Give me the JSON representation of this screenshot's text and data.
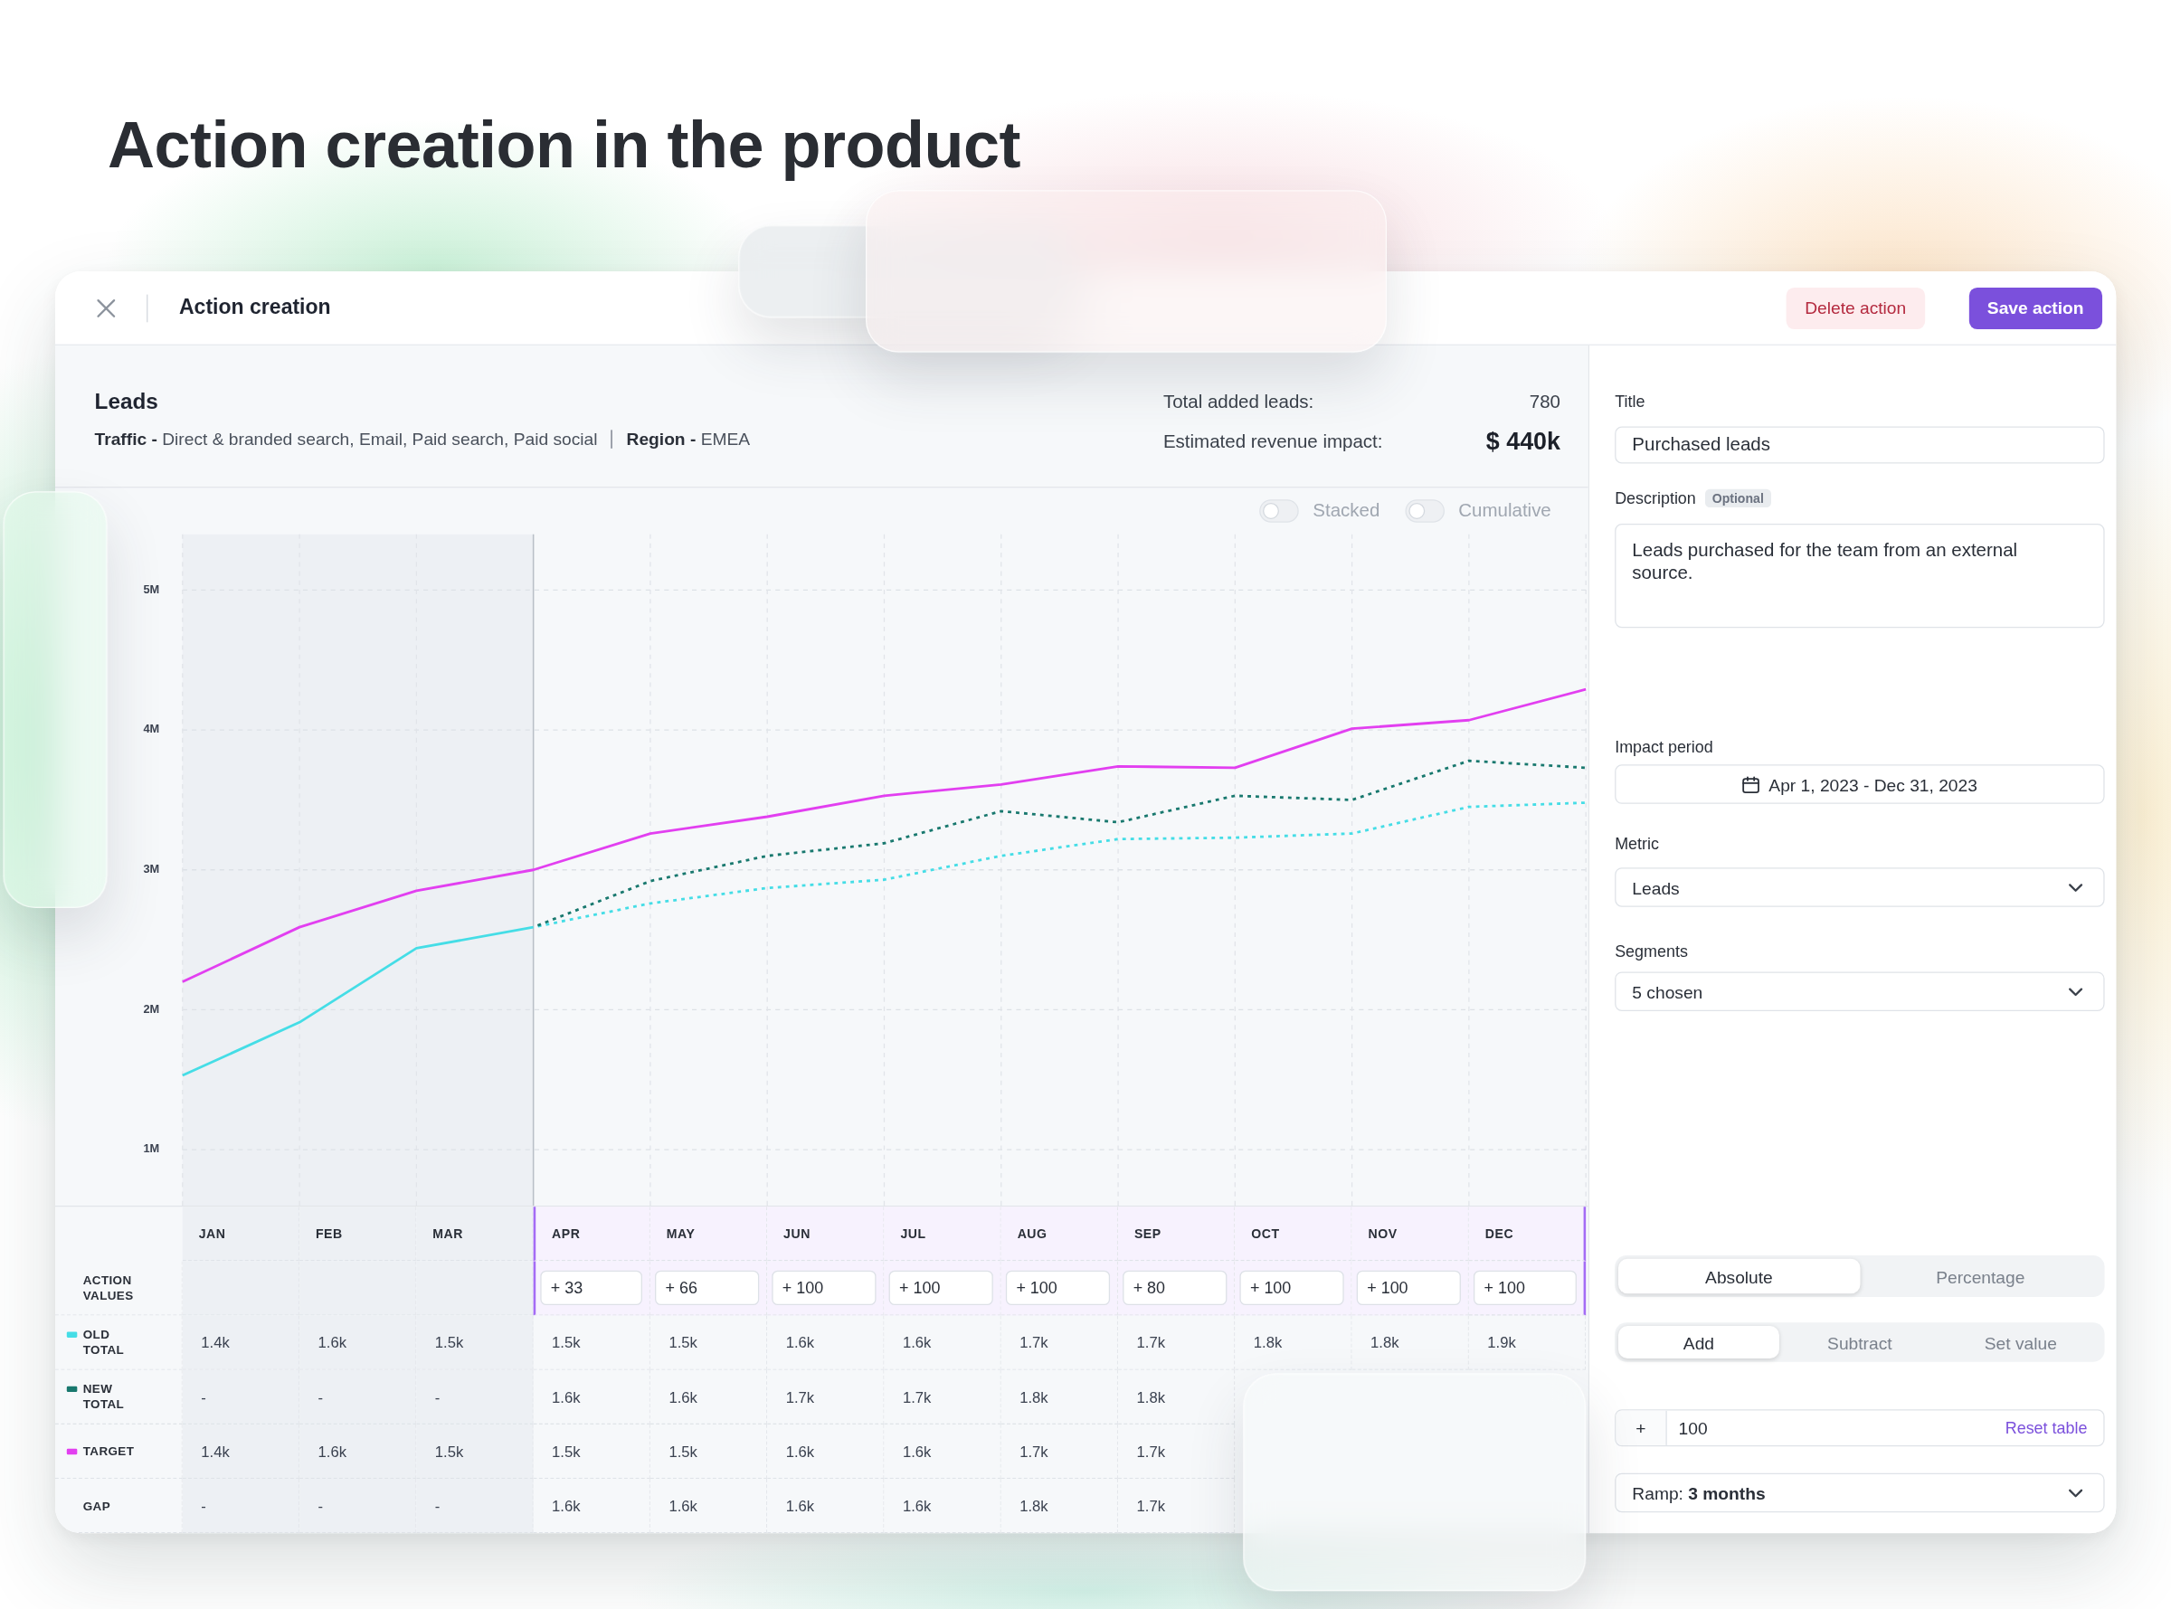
{
  "page_title": "Action creation in the product",
  "window": {
    "title": "Action creation",
    "buttons": [
      {
        "label": "Delete action",
        "kind": "danger"
      },
      {
        "label": "Save action",
        "kind": "primary"
      }
    ]
  },
  "metric_header": {
    "title": "Leads",
    "filters": [
      "**Traffic -** Direct & branded search, Email, Paid search, Paid social",
      "**Region -** EMEA"
    ],
    "stats": [
      {
        "label": "Total added leads:",
        "value": "780",
        "kind": "plain"
      },
      {
        "label": "Estimated revenue impact:",
        "value": "$ 440k",
        "kind": "emphasis"
      }
    ]
  },
  "chart": {
    "toggles": [
      {
        "label": "Stacked",
        "on": false
      },
      {
        "label": "Cumulative",
        "on": false
      }
    ],
    "chart_data": {
      "type": "line",
      "categories": [
        null,
        null,
        null,
        null,
        null,
        null,
        null,
        null,
        null,
        null,
        null,
        null,
        null
      ],
      "ylim": [
        0.6,
        5.4
      ],
      "yticks": [
        {
          "value": 1,
          "label": "1M"
        },
        {
          "value": 2,
          "label": "2M"
        },
        {
          "value": 3,
          "label": "3M"
        },
        {
          "value": 4,
          "label": "4M"
        },
        {
          "value": 5,
          "label": "5M"
        }
      ],
      "grid": true,
      "series": [
        {
          "color": "#45dde6",
          "line_style": "dashed",
          "values": [
            1.53,
            1.91,
            2.44,
            2.59,
            2.76,
            2.87,
            2.93,
            3.1,
            3.22,
            3.23,
            3.26,
            3.45,
            3.48
          ]
        },
        {
          "color": "#18786e",
          "line_style": "dashed",
          "values": [
            null,
            null,
            null,
            2.59,
            2.92,
            3.1,
            3.19,
            3.42,
            3.34,
            3.53,
            3.5,
            3.78,
            3.73
          ]
        },
        {
          "color": "#e23ff0",
          "line_style": "solid",
          "values": [
            2.2,
            2.59,
            2.85,
            3.0,
            3.26,
            3.38,
            3.53,
            3.61,
            3.74,
            3.73,
            4.01,
            4.07,
            4.29
          ]
        }
      ]
    }
  },
  "table": {
    "row_labels": [
      {
        "label": "ACTION VALUES",
        "kind": "input"
      },
      {
        "label": "OLD TOTAL",
        "kind": "value",
        "color": "#45dde6"
      },
      {
        "label": "NEW TOTAL",
        "kind": "value",
        "color": "#18786e"
      },
      {
        "label": "TARGET",
        "kind": "value",
        "color": "#e23ff0"
      },
      {
        "label": "GAP",
        "kind": "value"
      }
    ],
    "months": [
      {
        "label": "JAN",
        "kind": "actual",
        "cells": [
          "1.4k",
          "-",
          "1.4k",
          "-"
        ]
      },
      {
        "label": "FEB",
        "kind": "actual",
        "cells": [
          "1.6k",
          "-",
          "1.6k",
          "-"
        ]
      },
      {
        "label": "MAR",
        "kind": "actual",
        "cells": [
          "1.5k",
          "-",
          "1.5k",
          "-"
        ]
      },
      {
        "label": "APR",
        "kind": "planned",
        "action": "+ 33",
        "cells": [
          "1.5k",
          "1.6k",
          "1.5k",
          "1.6k"
        ]
      },
      {
        "label": "MAY",
        "kind": "planned",
        "action": "+ 66",
        "cells": [
          "1.5k",
          "1.6k",
          "1.5k",
          "1.6k"
        ]
      },
      {
        "label": "JUN",
        "kind": "planned",
        "action": "+ 100",
        "cells": [
          "1.6k",
          "1.7k",
          "1.6k",
          "1.6k"
        ]
      },
      {
        "label": "JUL",
        "kind": "planned",
        "action": "+ 100",
        "cells": [
          "1.6k",
          "1.7k",
          "1.6k",
          "1.6k"
        ]
      },
      {
        "label": "AUG",
        "kind": "planned",
        "action": "+ 100",
        "cells": [
          "1.7k",
          "1.8k",
          "1.7k",
          "1.8k"
        ]
      },
      {
        "label": "SEP",
        "kind": "planned",
        "action": "+ 80",
        "cells": [
          "1.7k",
          "1.8k",
          "1.7k",
          "1.7k"
        ]
      },
      {
        "label": "OCT",
        "kind": "planned",
        "action": "+ 100",
        "cells": [
          "1.8k"
        ]
      },
      {
        "label": "NOV",
        "kind": "planned",
        "action": "+ 100",
        "cells": [
          "1.8k"
        ]
      },
      {
        "label": "DEC",
        "kind": "planned",
        "action": "+ 100",
        "cells": [
          "1.9k"
        ]
      }
    ]
  },
  "form": {
    "title_field": {
      "label": "Title",
      "value": "Purchased leads"
    },
    "description_field": {
      "label": "Description",
      "badge": "Optional",
      "value": "Leads purchased for the team from an external source."
    },
    "impact_period_field": {
      "label": "Impact period",
      "value": "Apr 1, 2023 - Dec 31, 2023"
    },
    "metric_field": {
      "label": "Metric",
      "value": "Leads"
    },
    "segments_field": {
      "label": "Segments",
      "value": "5 chosen"
    },
    "value_type": [
      {
        "label": "Absolute",
        "selected": true
      },
      {
        "label": "Percentage",
        "selected": false
      }
    ],
    "operation": [
      {
        "label": "Add",
        "selected": true
      },
      {
        "label": "Subtract",
        "selected": false
      },
      {
        "label": "Set value",
        "selected": false
      }
    ],
    "amount": {
      "prefix": "+",
      "value": "100",
      "link": "Reset table"
    },
    "ramp": {
      "value": "Ramp: **3 months**"
    }
  }
}
